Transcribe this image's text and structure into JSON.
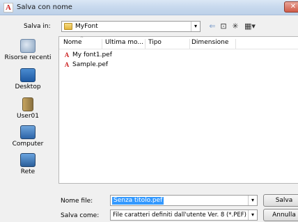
{
  "window": {
    "title": "Salva con nome",
    "close_label": "✕"
  },
  "toolbar": {
    "save_in_label": "Salva in:",
    "current_folder": "MyFont",
    "combo_arrow": "▾",
    "back_glyph": "⇐",
    "up_glyph": "⊡",
    "new_folder_glyph": "✳",
    "view_glyph": "▦▾"
  },
  "places": [
    {
      "label": "Risorse recenti",
      "icon": "recent-places-icon"
    },
    {
      "label": "Desktop",
      "icon": "desktop-icon"
    },
    {
      "label": "User01",
      "icon": "user-folder-icon"
    },
    {
      "label": "Computer",
      "icon": "computer-icon"
    },
    {
      "label": "Rete",
      "icon": "network-icon"
    }
  ],
  "filelist": {
    "columns": [
      "Nome",
      "Ultima mo...",
      "Tipo",
      "Dimensione"
    ],
    "sort_indicator": "^",
    "files": [
      {
        "name": "My font1.pef",
        "icon_glyph": "A"
      },
      {
        "name": "Sample.pef",
        "icon_glyph": "A"
      }
    ]
  },
  "form": {
    "filename_label": "Nome file:",
    "filename_value": "Senza titolo.pef",
    "filetype_label": "Salva come:",
    "filetype_value": "File caratteri definiti dall'utente Ver. 8 (*.PEF)",
    "save_button": "Salva",
    "cancel_button": "Annulla"
  },
  "colors": {
    "selection": "#3399ff",
    "file_icon_red": "#cc2222",
    "titlebar": "#c9daee"
  }
}
